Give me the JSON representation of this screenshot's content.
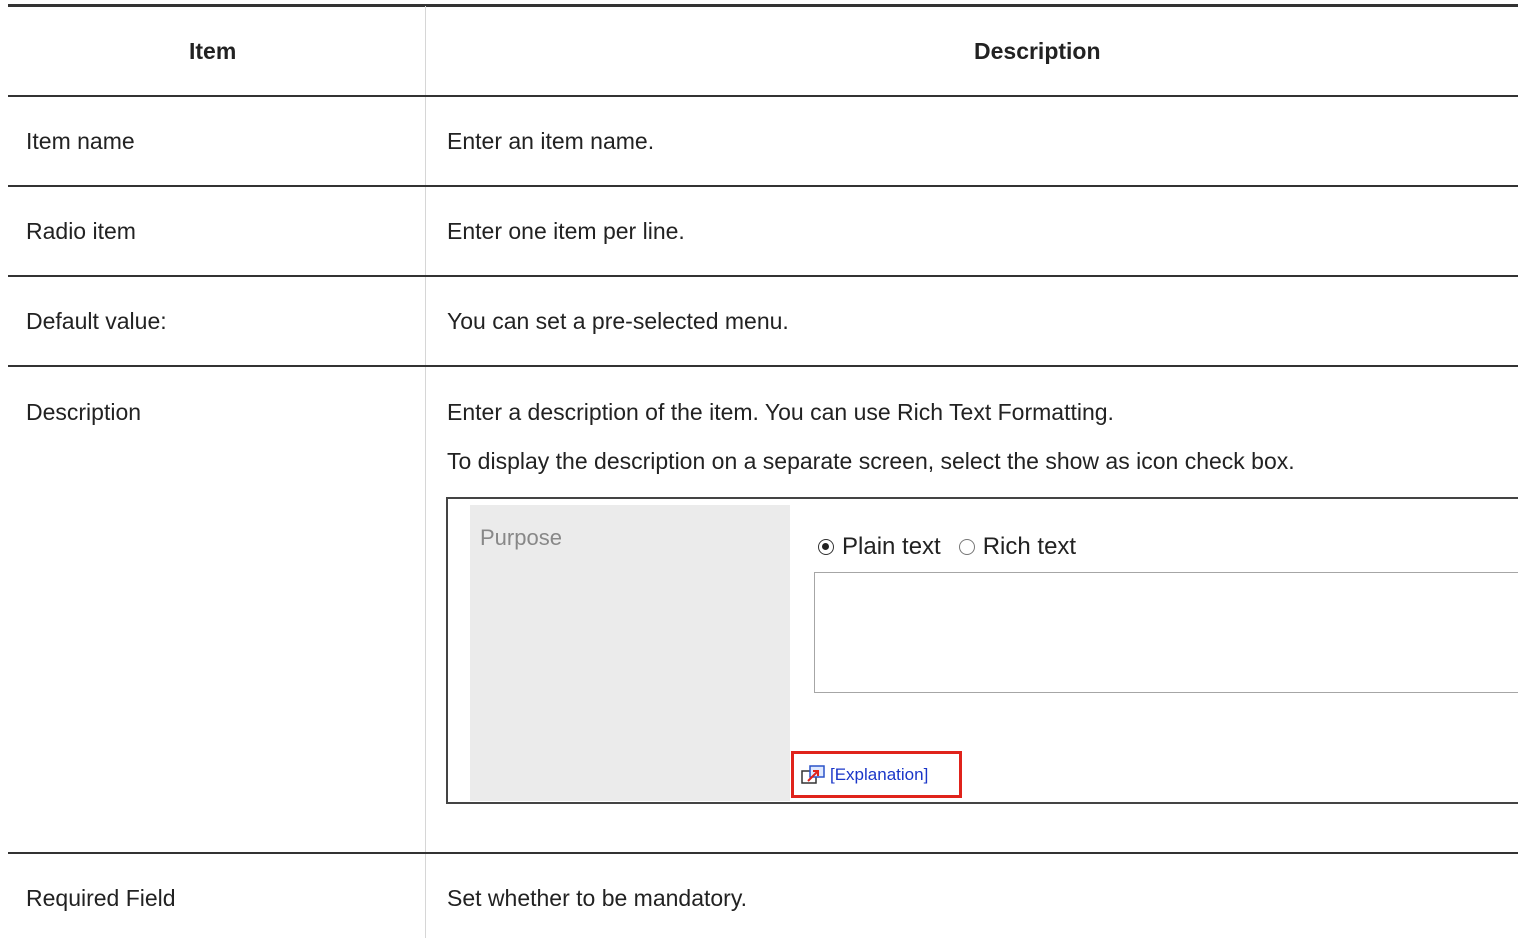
{
  "headers": {
    "item": "Item",
    "description": "Description"
  },
  "rows": [
    {
      "item": "Item name",
      "description": "Enter an item name."
    },
    {
      "item": "Radio item",
      "description": "Enter one item per line."
    },
    {
      "item": "Default value:",
      "description": "You can set a pre-selected menu."
    },
    {
      "item": "Description",
      "description": "Enter a description of the item. You can use Rich Text Formatting.",
      "description2": "To display the description on a separate screen, select the show as icon check box."
    },
    {
      "item": "Required Field",
      "description": "Set whether to be mandatory."
    }
  ],
  "screenshot": {
    "label": "Purpose",
    "radio_plain": "Plain text",
    "radio_rich": "Rich text",
    "selected": "Plain text",
    "link": "[Explanation]",
    "highlight_color": "#e0231b",
    "link_color": "#1a36c8"
  }
}
